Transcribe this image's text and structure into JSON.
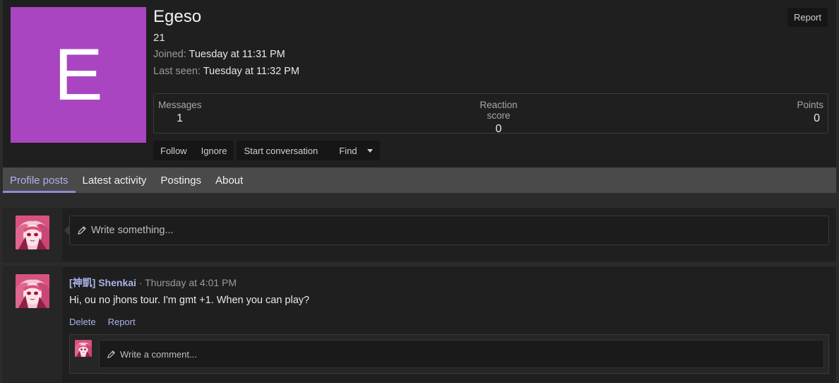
{
  "profile": {
    "avatar_letter": "E",
    "avatar_color": "#a945c0",
    "username": "Egeso",
    "user_title": "21",
    "joined_label": "Joined:",
    "joined_value": "Tuesday at 11:31 PM",
    "last_seen_label": "Last seen:",
    "last_seen_value": "Tuesday at 11:32 PM",
    "report_label": "Report",
    "stats": {
      "messages_label": "Messages",
      "messages_value": "1",
      "reaction_label": "Reaction score",
      "reaction_value": "0",
      "points_label": "Points",
      "points_value": "0"
    },
    "actions": {
      "follow": "Follow",
      "ignore": "Ignore",
      "start_conversation": "Start conversation",
      "find": "Find"
    }
  },
  "tabs": [
    {
      "label": "Profile posts",
      "active": true
    },
    {
      "label": "Latest activity",
      "active": false
    },
    {
      "label": "Postings",
      "active": false
    },
    {
      "label": "About",
      "active": false
    }
  ],
  "composer": {
    "placeholder": "Write something..."
  },
  "post": {
    "author": "[神凱] Shenkai",
    "separator": "·",
    "datetime": "Thursday at 4:01 PM",
    "body": "Hi, ou no jhons tour. I'm gmt +1. When you can play?",
    "delete_label": "Delete",
    "report_label": "Report",
    "comment_placeholder": "Write a comment..."
  },
  "colors": {
    "accent": "#a9b3e8",
    "tab_underline": "#8c8ad6",
    "background": "#1f1f1f"
  }
}
